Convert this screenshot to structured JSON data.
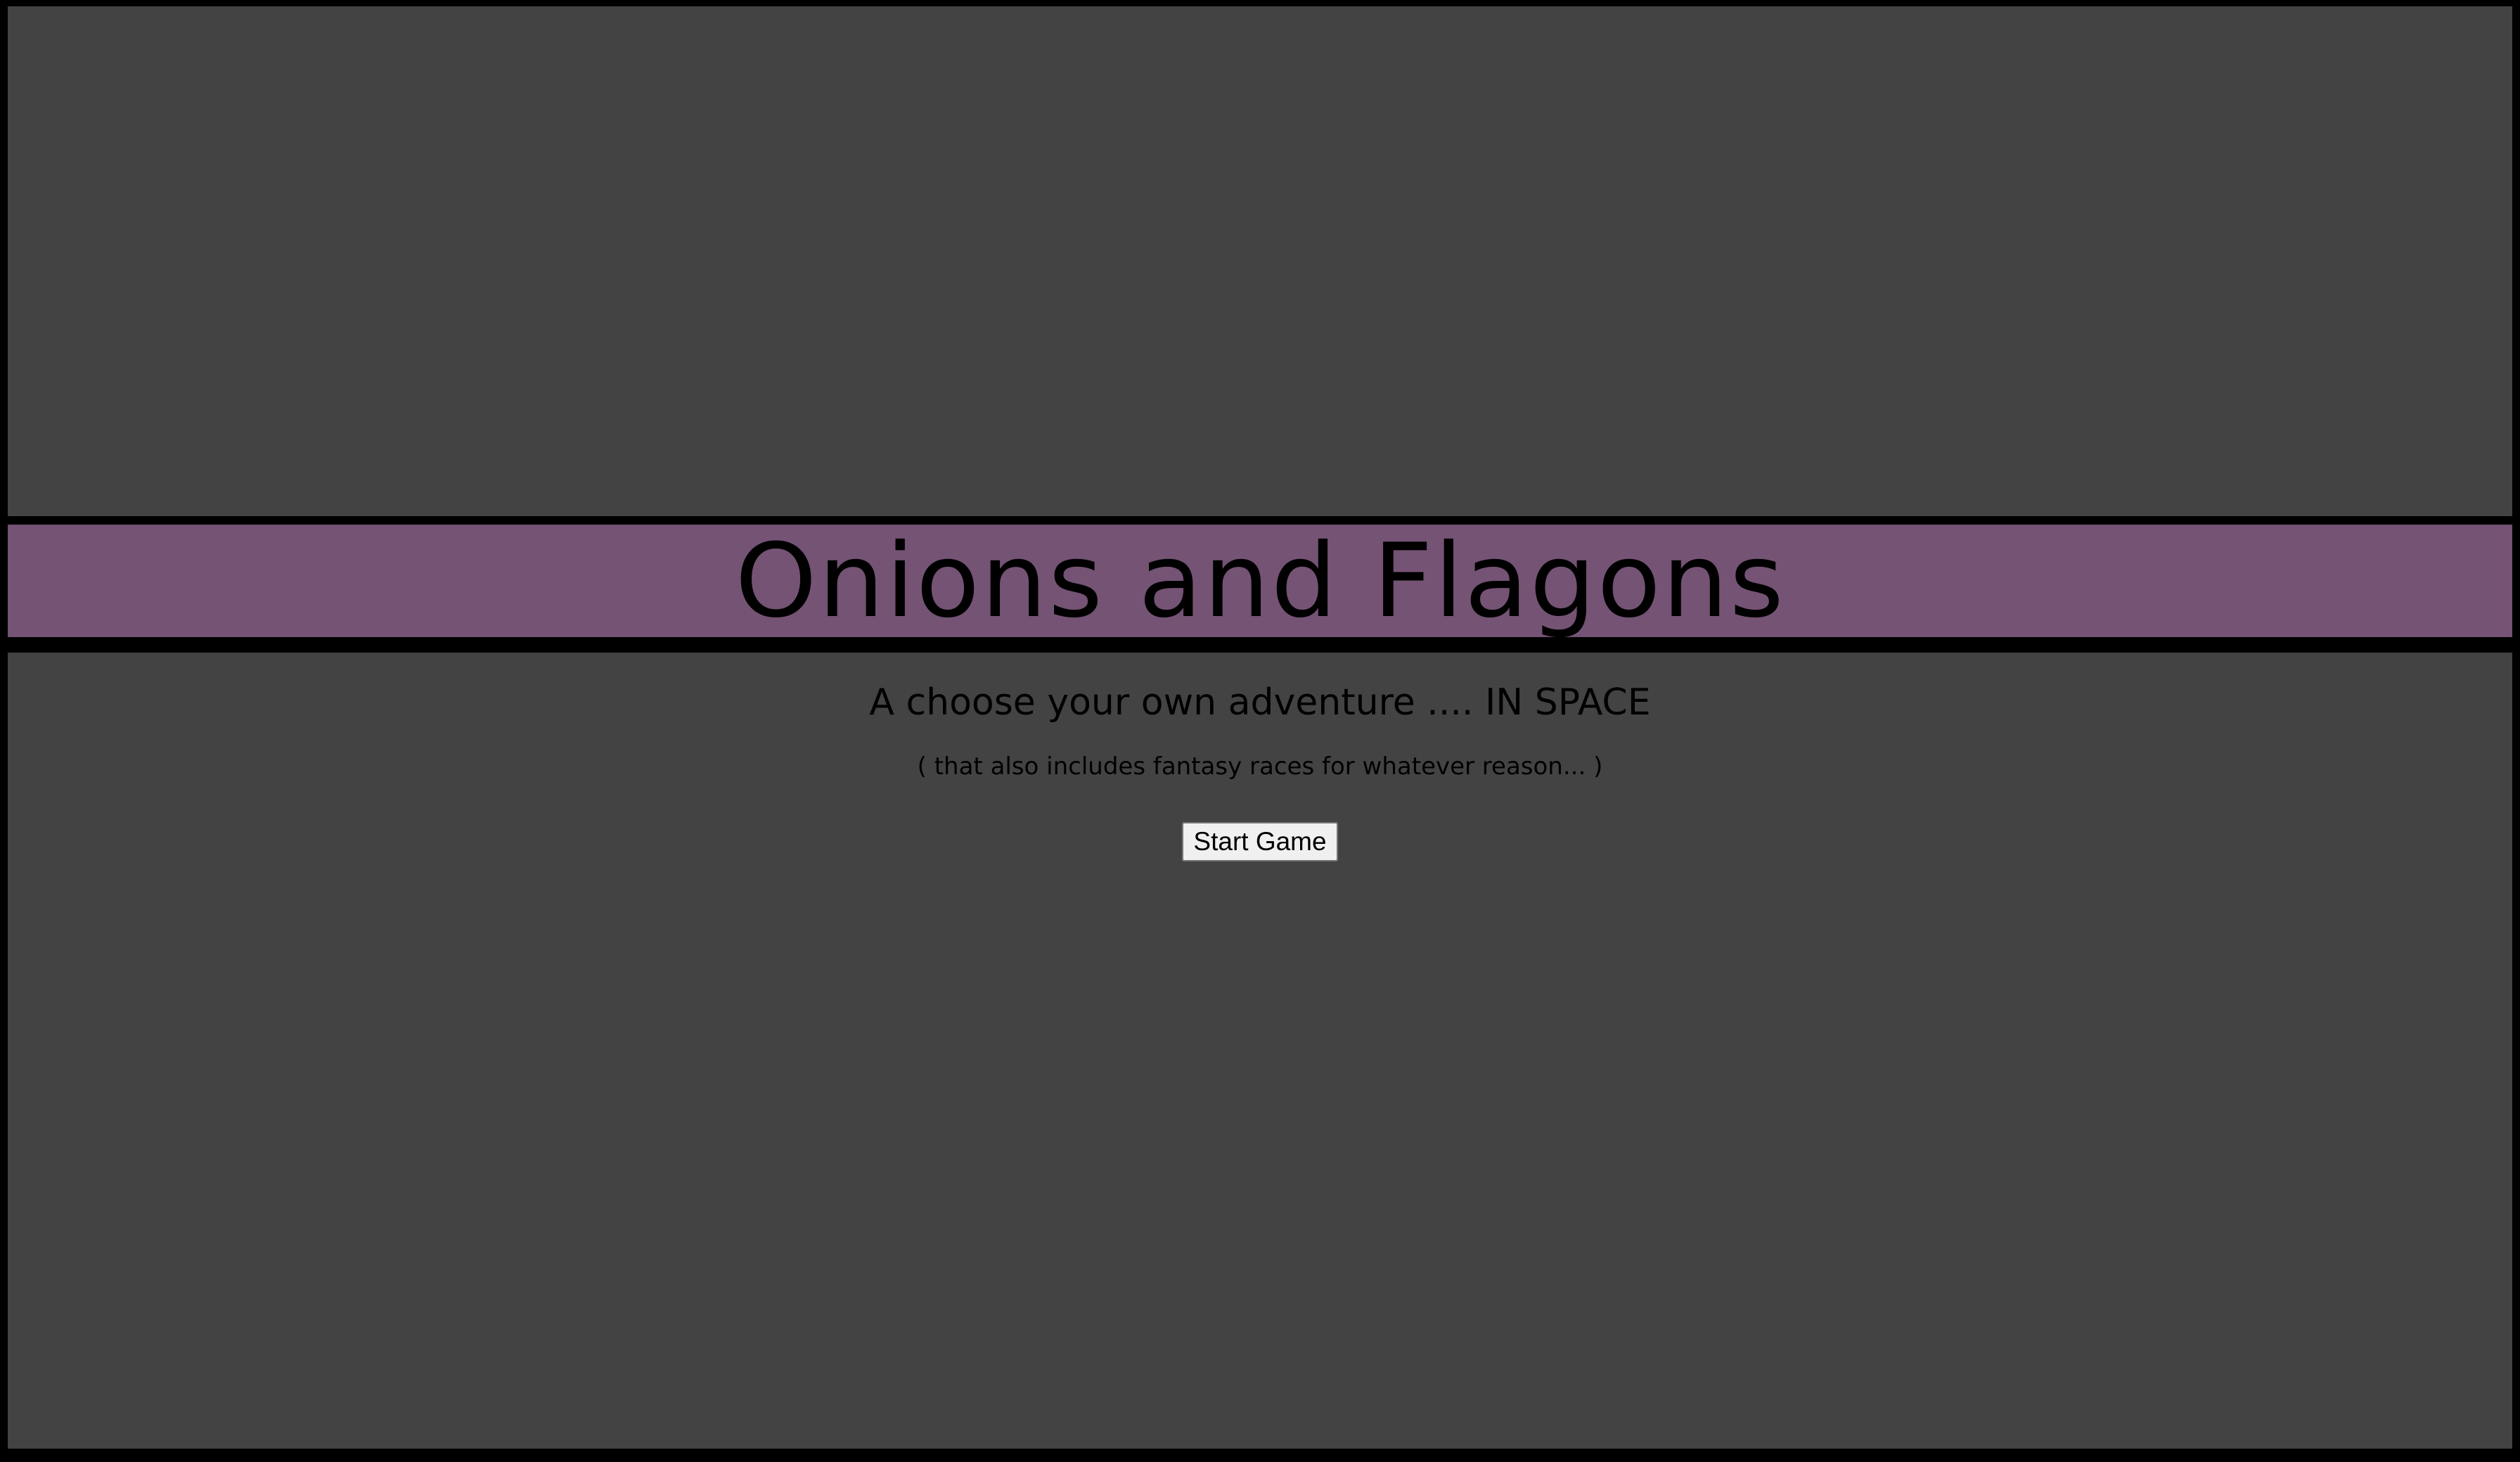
{
  "game": {
    "title": "Onions and Flagons",
    "subtitle": "A choose your own adventure .... IN SPACE",
    "note": "( that also includes fantasy races for whatever reason... )",
    "start_button_label": "Start Game"
  },
  "colors": {
    "background": "#434343",
    "banner": "#745374",
    "border": "#000000",
    "text": "#000000"
  }
}
